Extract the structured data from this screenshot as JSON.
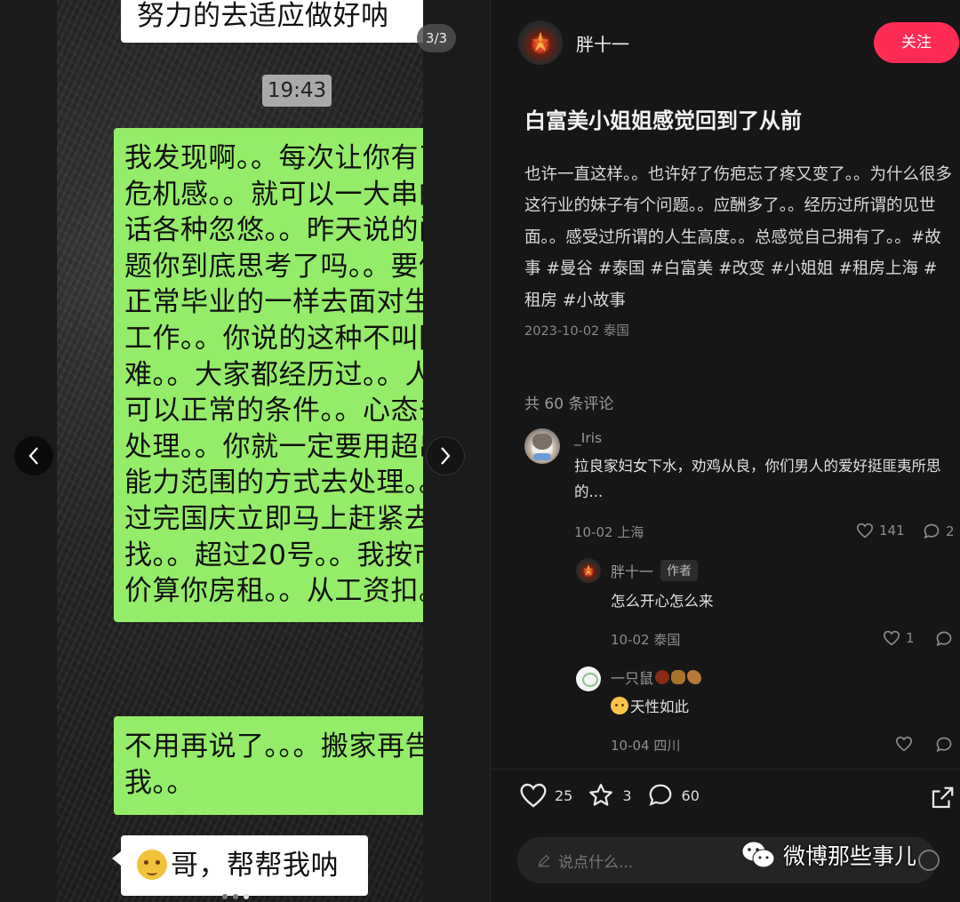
{
  "viewer": {
    "page_counter": "3/3",
    "chat": {
      "top_bubble": "努力的去适应做好呐",
      "timestamp": "19:43",
      "long_bubble": "我发现啊。。每次让你有了危机感。。就可以一大串的话各种忽悠。。昨天说的问题你到底思考了吗。。要像正常毕业的一样去面对生活工作。。你说的这种不叫困难。。大家都经历过。。人家可以正常的条件。。心态去处理。。你就一定要用超出能力范围的方式去处理。。过完国庆立即马上赶紧去找。。超过20号。。我按市价算你房租。。从工资扣。。",
      "short_bubble": "不用再说了。。。搬家再告诉我。。",
      "bottom_bubble": "哥，帮帮我呐"
    }
  },
  "author": {
    "name": "胖十一",
    "follow_label": "关注"
  },
  "post": {
    "title": "白富美小姐姐感觉回到了从前",
    "body": "也许一直这样。。也许好了伤疤忘了疼又变了。。为什么很多这行业的妹子有个问题。。应酬多了。。经历过所谓的见世面。。感受过所谓的人生高度。。总感觉自己拥有了。。",
    "tags": [
      "#故事",
      "#曼谷",
      "#泰国",
      "#白富美",
      "#改变",
      "#小姐姐",
      "#租房上海",
      "#租房",
      "#小故事"
    ],
    "meta": "2023-10-02 泰国"
  },
  "comments": {
    "count_label": "共 60 条评论",
    "items": [
      {
        "name": "_Iris",
        "text": "拉良家妇女下水，劝鸡从良，你们男人的爱好挺匪夷所思的...",
        "meta": "10-02 上海",
        "likes": "141",
        "replies": "2"
      }
    ],
    "replies": [
      {
        "name": "胖十一",
        "badge": "作者",
        "text": "怎么开心怎么来",
        "meta": "10-02 泰国",
        "likes": "1"
      },
      {
        "name": "一只鼠",
        "text": "天性如此",
        "meta": "10-04 四川"
      }
    ]
  },
  "actions": {
    "likes": "25",
    "favorites": "3",
    "comments": "60"
  },
  "input": {
    "placeholder": "说点什么..."
  },
  "watermark": "微博那些事儿",
  "colors": {
    "follow": "#fe2c55",
    "chat_green": "#95ec69"
  }
}
